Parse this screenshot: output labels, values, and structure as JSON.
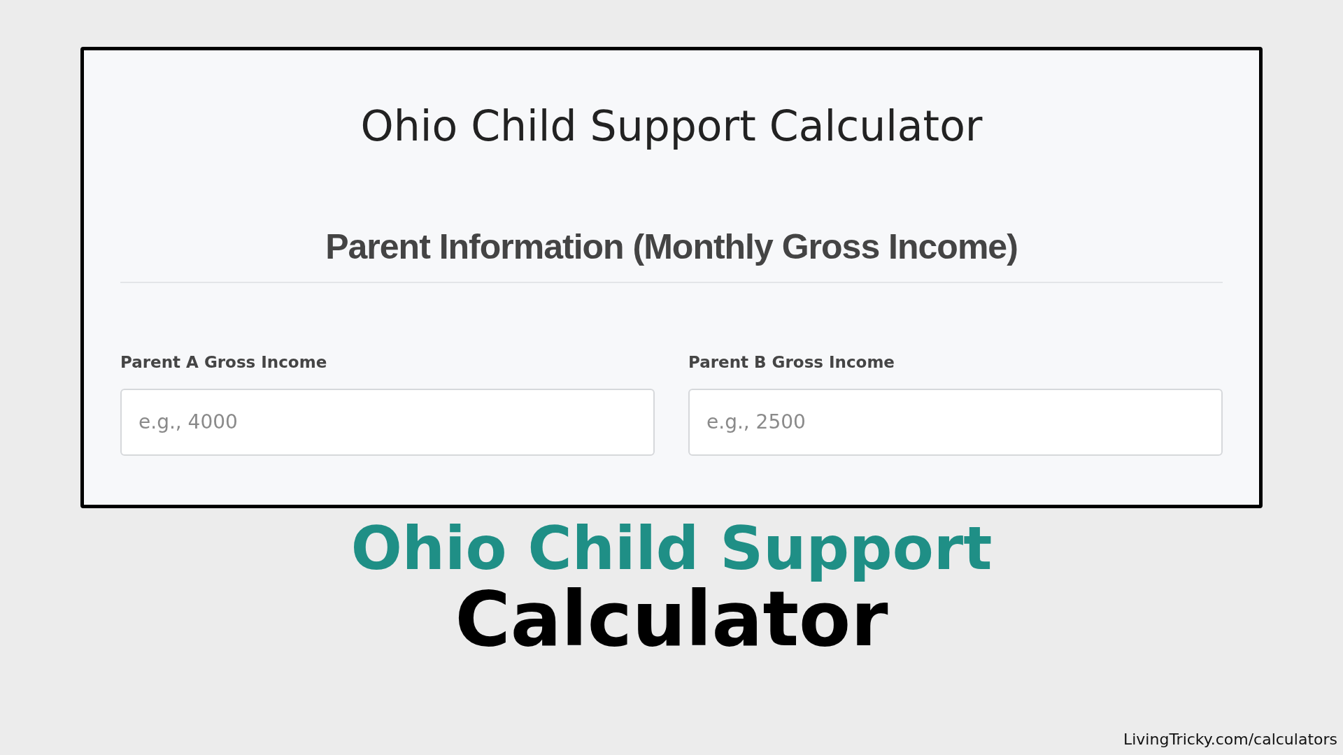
{
  "calculator": {
    "title": "Ohio Child Support Calculator",
    "section_heading": "Parent Information (Monthly Gross Income)",
    "fields": [
      {
        "label": "Parent A Gross Income",
        "placeholder": "e.g., 4000"
      },
      {
        "label": "Parent B Gross Income",
        "placeholder": "e.g., 2500"
      }
    ]
  },
  "headline": {
    "line_1": "Ohio Child Support",
    "line_2": "Calculator"
  },
  "credit": "LivingTricky.com/calculators"
}
